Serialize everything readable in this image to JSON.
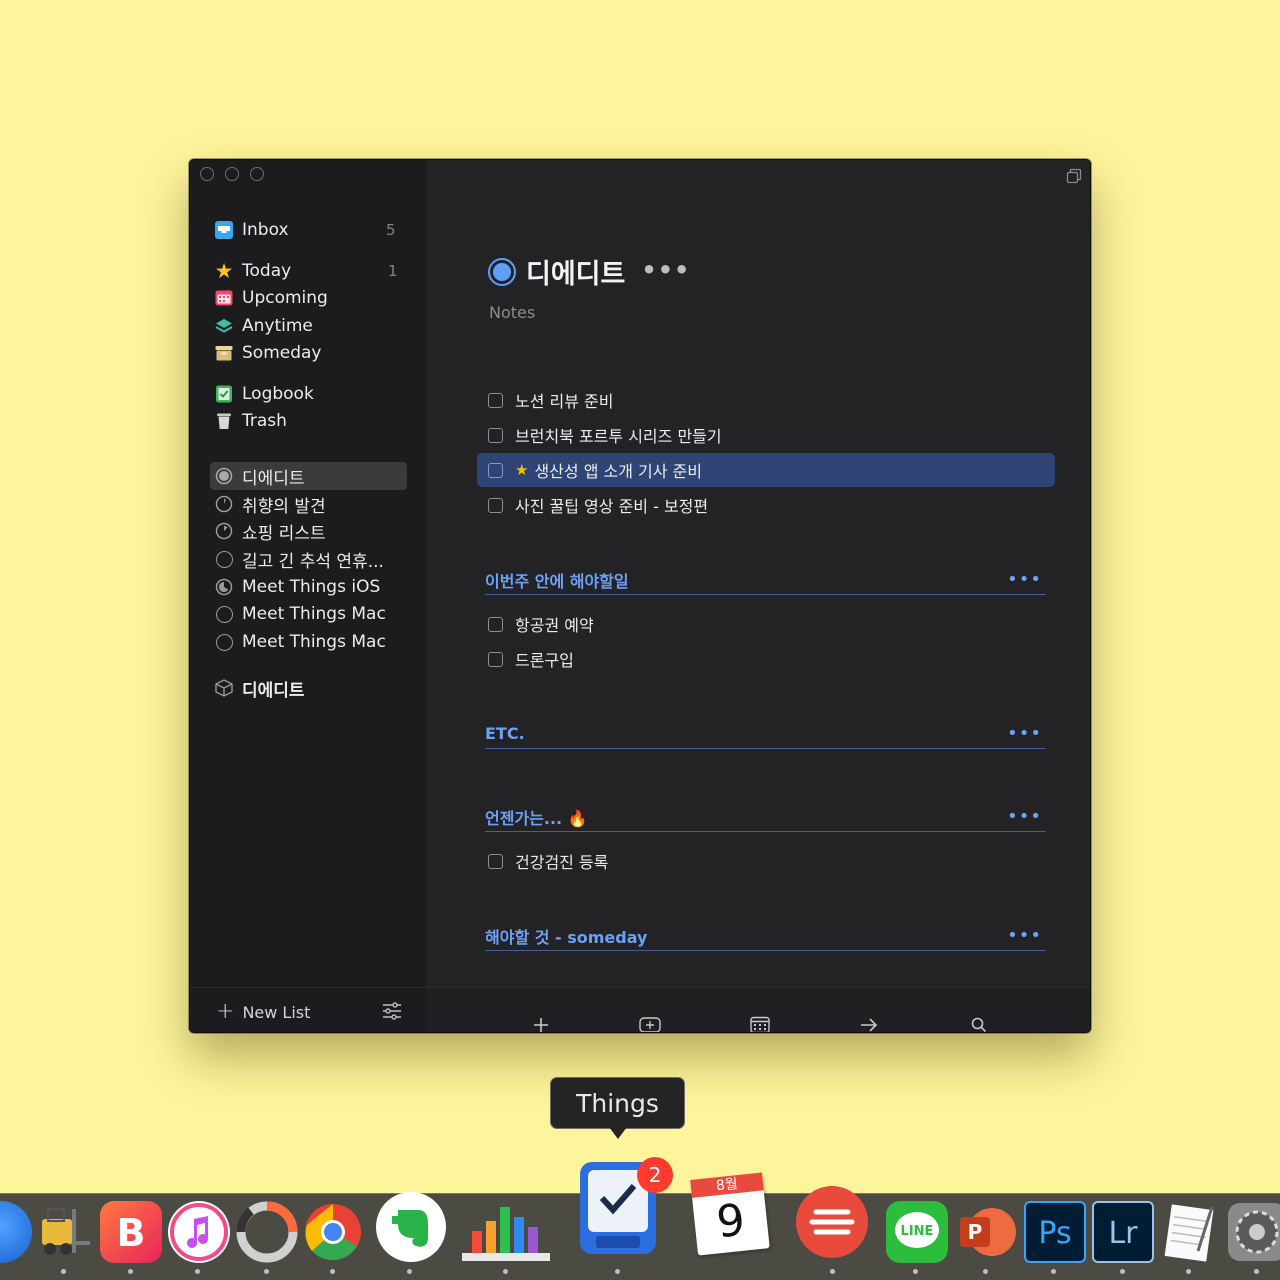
{
  "sidebar": {
    "inbox": {
      "label": "Inbox",
      "count": "5"
    },
    "today": {
      "label": "Today",
      "count": "1"
    },
    "upcoming": {
      "label": "Upcoming"
    },
    "anytime": {
      "label": "Anytime"
    },
    "someday": {
      "label": "Someday"
    },
    "logbook": {
      "label": "Logbook"
    },
    "trash": {
      "label": "Trash"
    },
    "projects": [
      {
        "label": "디에디트"
      },
      {
        "label": "취향의 발견"
      },
      {
        "label": "쇼핑 리스트"
      },
      {
        "label": "길고 긴 추석 연휴..."
      },
      {
        "label": "Meet Things iOS"
      },
      {
        "label": "Meet Things Mac"
      },
      {
        "label": "Meet Things Mac"
      }
    ],
    "area": {
      "label": "디에디트"
    },
    "new_list": "New List"
  },
  "project": {
    "title": "디에디트",
    "more": "•••",
    "notes_placeholder": "Notes"
  },
  "tasks": [
    {
      "label": "노션 리뷰 준비"
    },
    {
      "label": "브런치북 포르투 시리즈 만들기"
    },
    {
      "label": "생산성 앱 소개 기사 준비",
      "starred": true
    },
    {
      "label": "사진 꿀팁 영상 준비 - 보정편"
    }
  ],
  "headings": [
    {
      "label": "이번주 안에 해야할일",
      "tasks": [
        {
          "label": "항공권 예약"
        },
        {
          "label": "드론구입"
        }
      ]
    },
    {
      "label": "ETC.",
      "tasks": []
    },
    {
      "label": "언젠가는... 🔥",
      "tasks": [
        {
          "label": "건강검진 등록"
        }
      ]
    },
    {
      "label": "해야할 것 - someday",
      "tasks": []
    }
  ],
  "heading_more": "•••",
  "tooltip": "Things",
  "dock": {
    "things_badge": "2",
    "calendar_month": "8월",
    "calendar_day": "9"
  },
  "colors": {
    "accent": "#5f9efb",
    "selection": "#2e4475",
    "heading": "#6ca1f7",
    "desktop": "#fdf59c"
  }
}
